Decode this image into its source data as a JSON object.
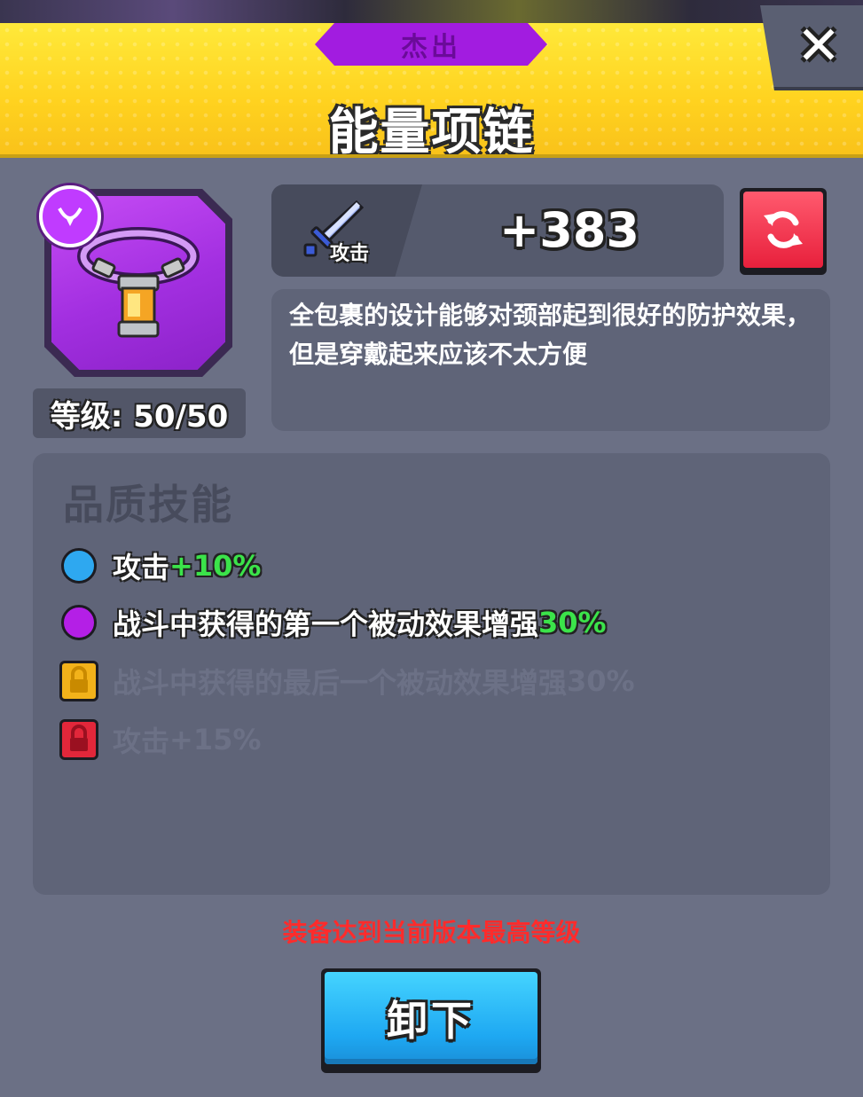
{
  "header": {
    "rarity_label": "杰出",
    "item_name": "能量项链",
    "close_label": "✕"
  },
  "item": {
    "level_text": "等级: 50/50",
    "slot_icon": "necklace-slot-icon",
    "image_icon": "energy-necklace-icon"
  },
  "stat": {
    "icon": "sword-icon",
    "label": "攻击",
    "value": "+383"
  },
  "refresh": {
    "icon": "refresh-icon"
  },
  "description": {
    "text": "全包裹的设计能够对颈部起到很好的防护效果，但是穿戴起来应该不太方便"
  },
  "skills": {
    "title": "品质技能",
    "items": [
      {
        "text": "攻击",
        "value": "+10%",
        "color": "#2ea8f0",
        "locked": false
      },
      {
        "text": "战斗中获得的第一个被动效果增强",
        "value": "30%",
        "color": "#b41fe6",
        "locked": false
      },
      {
        "text": "战斗中获得的最后一个被动效果增强",
        "value": "30%",
        "color": "#f2b21a",
        "locked": true
      },
      {
        "text": "攻击",
        "value": "+15%",
        "color": "#e2273a",
        "locked": true
      }
    ]
  },
  "footer": {
    "max_note": "装备达到当前版本最高等级",
    "unequip_label": "卸下"
  },
  "colors": {
    "header_yellow": "#ffd21f",
    "rarity_purple": "#a21ce0",
    "panel_bg": "#5f6478",
    "green_value": "#3be34a",
    "warning_red": "#ff2b2b",
    "button_blue": "#1ea8f2"
  }
}
